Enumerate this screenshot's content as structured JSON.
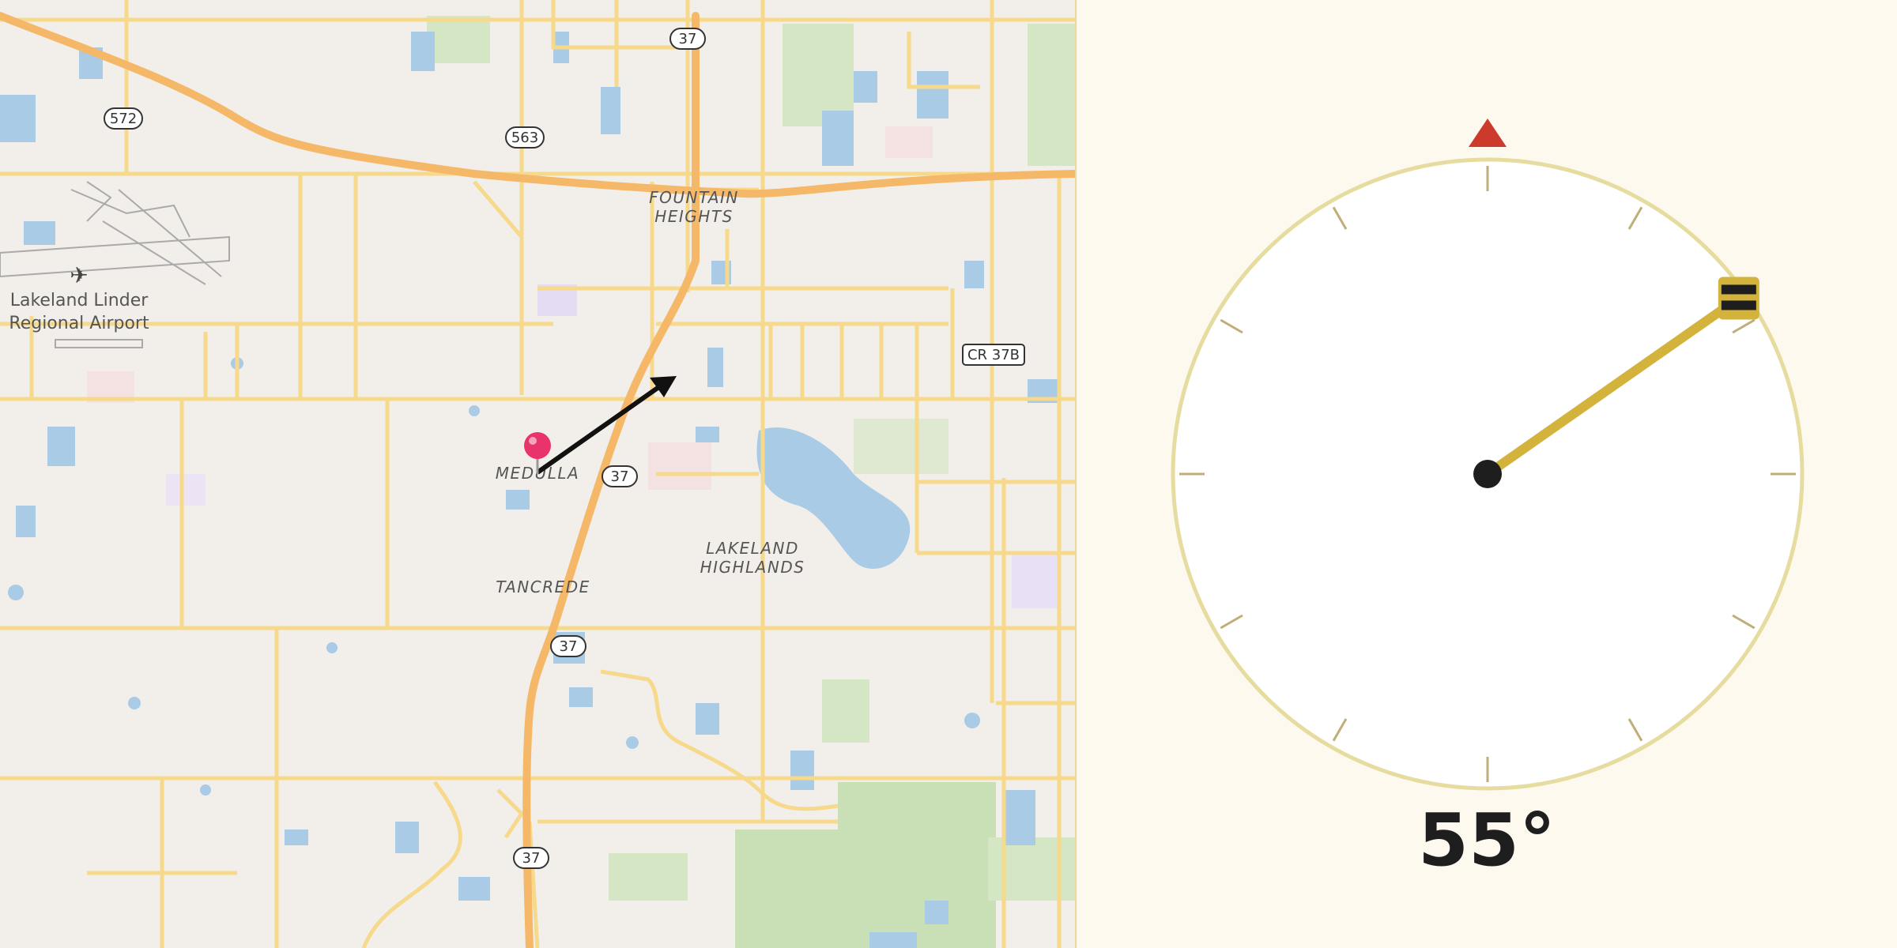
{
  "map": {
    "airport_lines": [
      "Lakeland Linder",
      "Regional Airport"
    ],
    "places": {
      "fountain_heights": [
        "FOUNTAIN",
        "HEIGHTS"
      ],
      "medulla": "MEDULLA",
      "lakeland_highlands": [
        "LAKELAND",
        "HIGHLANDS"
      ],
      "tancrede": "TANCREDE"
    },
    "shields": {
      "s37_top": "37",
      "s572": "572",
      "s563": "563",
      "scr37b": "CR 37B",
      "s37_mid": "37",
      "s37_low": "37",
      "s37_bottom": "37"
    },
    "colors": {
      "road": "#f7d98c",
      "highway": "#f5b868",
      "water": "#a9cbe6",
      "park": "#d5e6c4",
      "pin": "#e8336b",
      "arrow": "#111111"
    }
  },
  "compass": {
    "heading_deg": 55,
    "readout": "55°",
    "colors": {
      "ring": "#e7dca0",
      "needle": "#d4b33d",
      "north_marker": "#cc3a2c",
      "hub": "#1e1e1e"
    }
  }
}
